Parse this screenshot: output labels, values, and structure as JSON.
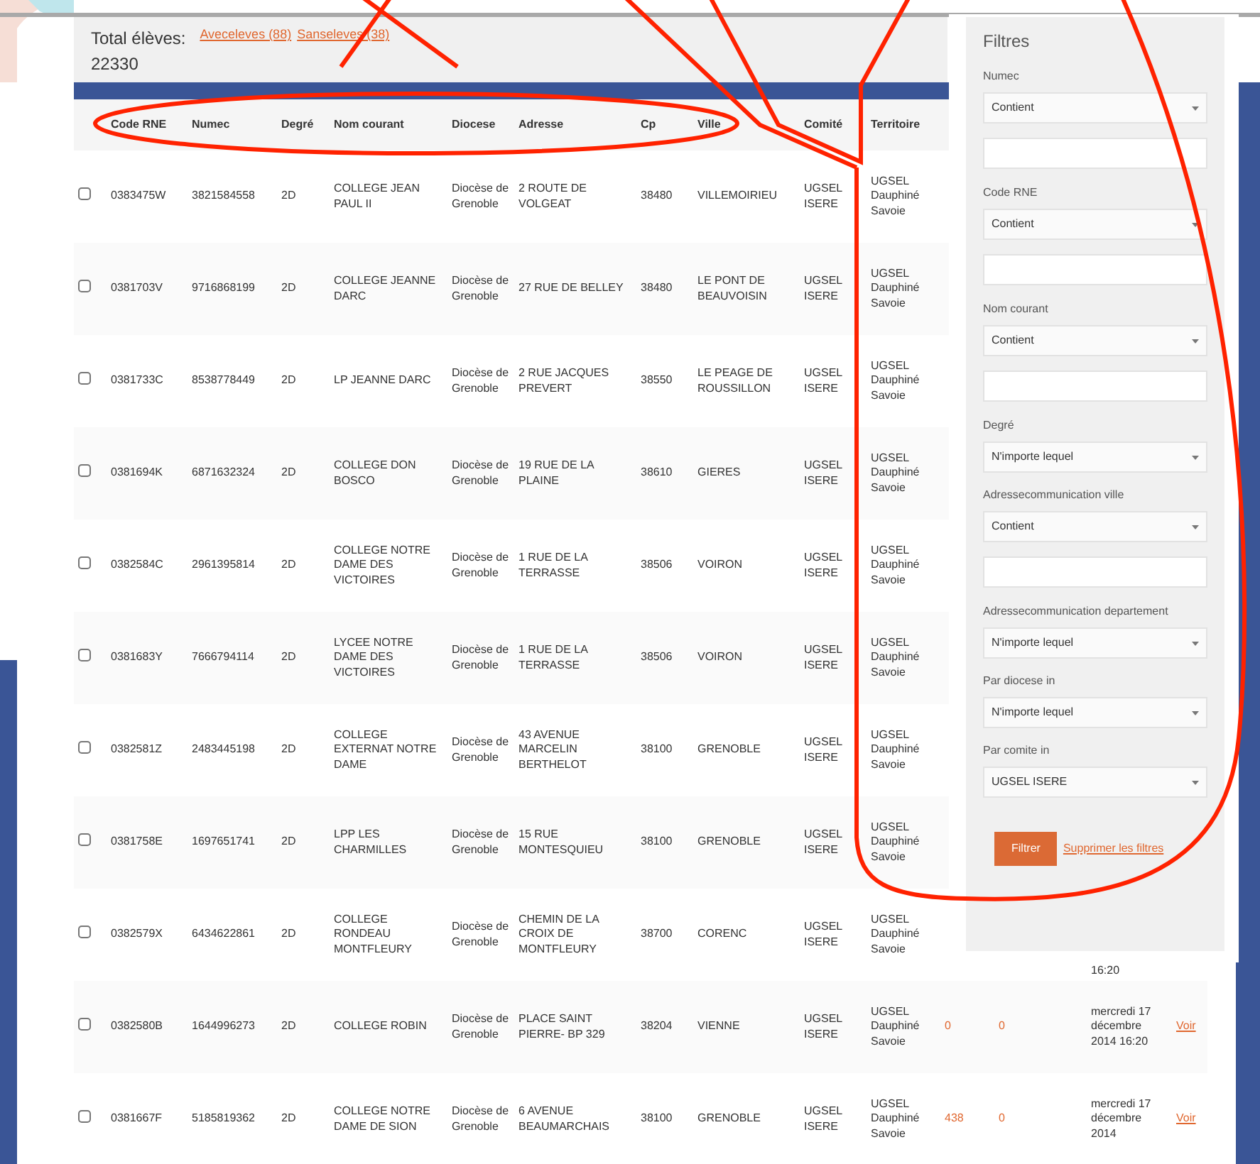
{
  "summary": {
    "label": "Total élèves:",
    "value": "22330",
    "links": [
      "Aveceleves (88)",
      "Sanseleves (38)"
    ]
  },
  "table": {
    "columns": [
      "Code RNE",
      "Numec",
      "Degré",
      "Nom courant",
      "Diocese",
      "Adresse",
      "Cp",
      "Ville",
      "Comité",
      "Territoire"
    ],
    "rows": [
      {
        "checked": false,
        "cells": [
          "0383475W",
          "3821584558",
          "2D",
          "COLLEGE JEAN PAUL II",
          "Diocèse de Grenoble",
          "2 ROUTE DE VOLGEAT",
          "38480",
          "VILLEMOIRIEU",
          "UGSEL ISERE",
          "UGSEL Dauphiné Savoie"
        ]
      },
      {
        "checked": false,
        "cells": [
          "0381703V",
          "9716868199",
          "2D",
          "COLLEGE JEANNE DARC",
          "Diocèse de Grenoble",
          "27 RUE DE BELLEY",
          "38480",
          "LE PONT DE BEAUVOISIN",
          "UGSEL ISERE",
          "UGSEL Dauphiné Savoie"
        ]
      },
      {
        "checked": false,
        "cells": [
          "0381733C",
          "8538778449",
          "2D",
          "LP JEANNE DARC",
          "Diocèse de Grenoble",
          "2 RUE JACQUES PREVERT",
          "38550",
          "LE PEAGE DE ROUSSILLON",
          "UGSEL ISERE",
          "UGSEL Dauphiné Savoie"
        ]
      },
      {
        "checked": false,
        "cells": [
          "0381694K",
          "6871632324",
          "2D",
          "COLLEGE DON BOSCO",
          "Diocèse de Grenoble",
          "19 RUE DE LA PLAINE",
          "38610",
          "GIERES",
          "UGSEL ISERE",
          "UGSEL Dauphiné Savoie"
        ]
      },
      {
        "checked": false,
        "cells": [
          "0382584C",
          "2961395814",
          "2D",
          "COLLEGE NOTRE DAME DES VICTOIRES",
          "Diocèse de Grenoble",
          "1 RUE DE LA TERRASSE",
          "38506",
          "VOIRON",
          "UGSEL ISERE",
          "UGSEL Dauphiné Savoie"
        ]
      },
      {
        "checked": false,
        "cells": [
          "0381683Y",
          "7666794114",
          "2D",
          "LYCEE NOTRE DAME DES VICTOIRES",
          "Diocèse de Grenoble",
          "1 RUE DE LA TERRASSE",
          "38506",
          "VOIRON",
          "UGSEL ISERE",
          "UGSEL Dauphiné Savoie"
        ]
      },
      {
        "checked": false,
        "cells": [
          "0382581Z",
          "2483445198",
          "2D",
          "COLLEGE EXTERNAT NOTRE DAME",
          "Diocèse de Grenoble",
          "43 AVENUE MARCELIN BERTHELOT",
          "38100",
          "GRENOBLE",
          "UGSEL ISERE",
          "UGSEL Dauphiné Savoie"
        ]
      },
      {
        "checked": false,
        "cells": [
          "0381758E",
          "1697651741",
          "2D",
          "LPP LES CHARMILLES",
          "Diocèse de Grenoble",
          "15 RUE MONTESQUIEU",
          "38100",
          "GRENOBLE",
          "UGSEL ISERE",
          "UGSEL Dauphiné Savoie"
        ]
      },
      {
        "checked": false,
        "cells": [
          "0382579X",
          "6434622861",
          "2D",
          "COLLEGE RONDEAU MONTFLEURY",
          "Diocèse de Grenoble",
          "CHEMIN DE LA CROIX DE MONTFLEURY",
          "38700",
          "CORENC",
          "UGSEL ISERE",
          "UGSEL Dauphiné Savoie"
        ],
        "date": "16:20"
      },
      {
        "checked": false,
        "cells": [
          "0382580B",
          "1644996273",
          "2D",
          "COLLEGE ROBIN",
          "Diocèse de Grenoble",
          "PLACE SAINT PIERRE- BP 329",
          "38204",
          "VIENNE",
          "UGSEL ISERE",
          "UGSEL Dauphiné Savoie"
        ],
        "counts": [
          "0",
          "0"
        ],
        "date": "mercredi 17 décembre 2014 16:20",
        "action": "Voir"
      },
      {
        "checked": false,
        "cells": [
          "0381667F",
          "5185819362",
          "2D",
          "COLLEGE NOTRE DAME DE SION",
          "Diocèse de Grenoble",
          "6 AVENUE BEAUMARCHAIS",
          "38100",
          "GRENOBLE",
          "UGSEL ISERE",
          "UGSEL Dauphiné Savoie"
        ],
        "counts": [
          "438",
          "0"
        ],
        "date": "mercredi 17 décembre 2014",
        "action": "Voir"
      }
    ]
  },
  "filters": {
    "title": "Filtres",
    "items": [
      {
        "kind": "text",
        "label": "Numec",
        "operator": "Contient"
      },
      {
        "kind": "text",
        "label": "Code RNE",
        "operator": "Contient"
      },
      {
        "kind": "text",
        "label": "Nom courant",
        "operator": "Contient"
      },
      {
        "kind": "choice",
        "label": "Degré",
        "operator": "N'importe lequel"
      },
      {
        "kind": "text",
        "label": "Adressecommunication ville",
        "operator": "Contient"
      },
      {
        "kind": "choice",
        "label": "Adressecommunication departement",
        "operator": "N'importe lequel"
      },
      {
        "kind": "choice",
        "label": "Par diocese in",
        "operator": "N'importe lequel"
      },
      {
        "kind": "choice",
        "label": "Par comite in",
        "operator": "UGSEL ISERE"
      }
    ],
    "submit": "Filtrer",
    "clear": "Supprimer les filtres"
  }
}
